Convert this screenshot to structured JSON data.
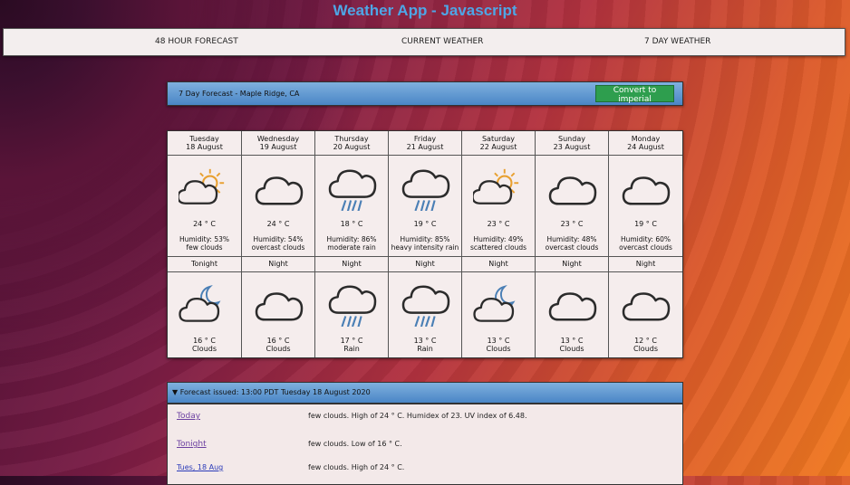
{
  "app": {
    "title": "Weather App - Javascript"
  },
  "nav": {
    "items": [
      "48 HOUR FORECAST",
      "CURRENT WEATHER",
      "7 DAY WEATHER"
    ]
  },
  "forecast": {
    "title": "7 Day Forecast - Maple Ridge, CA",
    "convert_label": "Convert to imperial"
  },
  "days": [
    {
      "weekday": "Tuesday",
      "date": "18 August",
      "icon": "sun-cloud-icon",
      "temp": "24 ° C",
      "humidity": "Humidity: 53%",
      "desc": "few clouds",
      "night_label": "Tonight",
      "night_icon": "moon-cloud-icon",
      "night_temp": "16 ° C",
      "night_desc": "Clouds"
    },
    {
      "weekday": "Wednesday",
      "date": "19 August",
      "icon": "cloud-icon",
      "temp": "24 ° C",
      "humidity": "Humidity: 54%",
      "desc": "overcast clouds",
      "night_label": "Night",
      "night_icon": "cloud-icon",
      "night_temp": "16 ° C",
      "night_desc": "Clouds"
    },
    {
      "weekday": "Thursday",
      "date": "20 August",
      "icon": "rain-cloud-icon",
      "temp": "18 ° C",
      "humidity": "Humidity: 86%",
      "desc": "moderate rain",
      "night_label": "Night",
      "night_icon": "rain-cloud-icon",
      "night_temp": "17 ° C",
      "night_desc": "Rain"
    },
    {
      "weekday": "Friday",
      "date": "21 August",
      "icon": "rain-cloud-icon",
      "temp": "19 ° C",
      "humidity": "Humidity: 85%",
      "desc": "heavy intensity rain",
      "night_label": "Night",
      "night_icon": "rain-cloud-icon",
      "night_temp": "13 ° C",
      "night_desc": "Rain"
    },
    {
      "weekday": "Saturday",
      "date": "22 August",
      "icon": "sun-cloud-icon",
      "temp": "23 ° C",
      "humidity": "Humidity: 49%",
      "desc": "scattered clouds",
      "night_label": "Night",
      "night_icon": "moon-cloud-icon",
      "night_temp": "13 ° C",
      "night_desc": "Clouds"
    },
    {
      "weekday": "Sunday",
      "date": "23 August",
      "icon": "cloud-icon",
      "temp": "23 ° C",
      "humidity": "Humidity: 48%",
      "desc": "overcast clouds",
      "night_label": "Night",
      "night_icon": "cloud-icon",
      "night_temp": "13 ° C",
      "night_desc": "Clouds"
    },
    {
      "weekday": "Monday",
      "date": "24 August",
      "icon": "cloud-icon",
      "temp": "19 ° C",
      "humidity": "Humidity: 60%",
      "desc": "overcast clouds",
      "night_label": "Night",
      "night_icon": "cloud-icon",
      "night_temp": "12 ° C",
      "night_desc": "Clouds"
    }
  ],
  "issued": {
    "label": "▼ Forecast issued: 13:00 PDT Tuesday 18 August 2020"
  },
  "text_forecast": [
    {
      "period": "Today",
      "text": "few clouds. High of 24 ° C. Humidex of 23. UV index of 6.48."
    },
    {
      "period": "Tonight",
      "text": "few clouds. Low of 16 ° C."
    },
    {
      "period": "Tues, 18 Aug",
      "text": "few clouds. High of 24 ° C."
    }
  ],
  "colors": {
    "title": "#4ea6e6",
    "header_blue": "#4a86c6",
    "button_green": "#2e9e4e",
    "sun": "#e8a030",
    "rain": "#4a7fb5"
  }
}
